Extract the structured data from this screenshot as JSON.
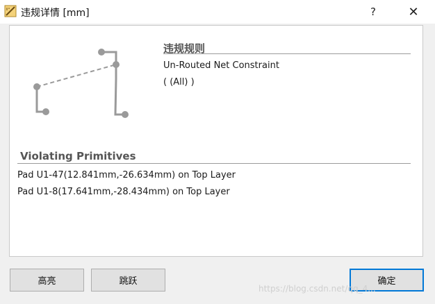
{
  "window": {
    "title": "违规详情 [mm]",
    "help_label": "?",
    "close_label": "✕",
    "app_icon": "ruler-pencil-icon"
  },
  "rule": {
    "heading": "违规规则",
    "name": "Un-Routed Net Constraint",
    "scope": "( (All) )"
  },
  "violations": {
    "heading": "Violating Primitives",
    "items": [
      "Pad U1-47(12.841mm,-26.634mm) on Top Layer",
      "Pad U1-8(17.641mm,-28.434mm) on Top Layer"
    ]
  },
  "buttons": {
    "highlight": "高亮",
    "jump": "跳跃",
    "ok": "确定"
  },
  "watermark": "https://blog.csdn.net/qq_4..."
}
